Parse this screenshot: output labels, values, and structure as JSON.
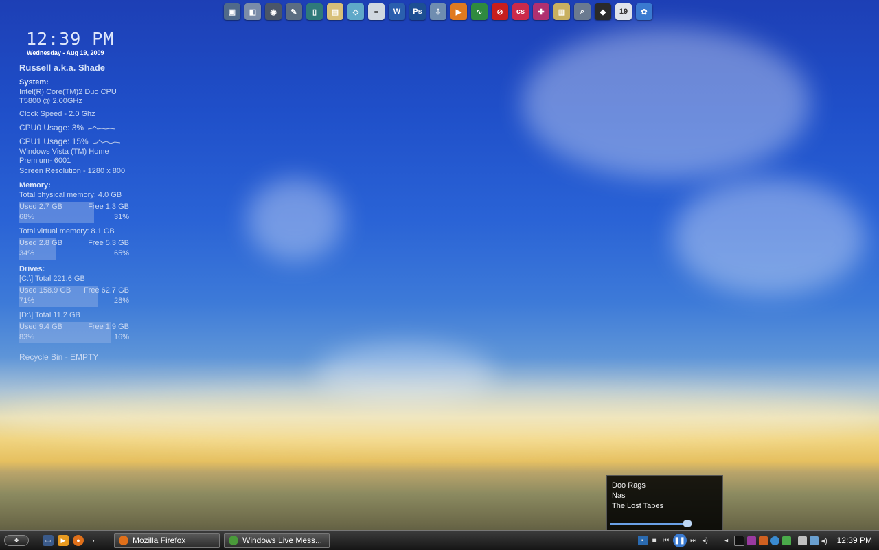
{
  "dock": {
    "icons": [
      {
        "name": "computer-icon",
        "color": "#506a8a",
        "glyph": "▣"
      },
      {
        "name": "documents-icon",
        "color": "#7b8ca8",
        "glyph": "◧"
      },
      {
        "name": "camera-icon",
        "color": "#4a5668",
        "glyph": "◉"
      },
      {
        "name": "tools-icon",
        "color": "#5b6d82",
        "glyph": "✎"
      },
      {
        "name": "mobile-icon",
        "color": "#2f7a7a",
        "glyph": "▯"
      },
      {
        "name": "folder-icon",
        "color": "#d8c078",
        "glyph": "▤"
      },
      {
        "name": "notes-icon",
        "color": "#5fa8c8",
        "glyph": "◇"
      },
      {
        "name": "text-file-icon",
        "color": "#d0d8e0",
        "glyph": "≡"
      },
      {
        "name": "word-icon",
        "color": "#2a5fae",
        "glyph": "W"
      },
      {
        "name": "photoshop-icon",
        "color": "#1d4f93",
        "glyph": "Ps"
      },
      {
        "name": "download-icon",
        "color": "#6f8db0",
        "glyph": "⇩"
      },
      {
        "name": "media-player-icon",
        "color": "#e07a20",
        "glyph": "▶"
      },
      {
        "name": "monitor-icon",
        "color": "#2f8a3f",
        "glyph": "∿"
      },
      {
        "name": "blocked-icon",
        "color": "#c81e1e",
        "glyph": "⊘"
      },
      {
        "name": "creative-suite-icon",
        "color": "#cc2a4a",
        "glyph": "cs"
      },
      {
        "name": "network-icon",
        "color": "#b03070",
        "glyph": "✚"
      },
      {
        "name": "archive-icon",
        "color": "#c8b060",
        "glyph": "▥"
      },
      {
        "name": "search-icon",
        "color": "#6a7a90",
        "glyph": "⌕"
      },
      {
        "name": "drive-icon",
        "color": "#2a2a2a",
        "glyph": "◆"
      },
      {
        "name": "calendar-icon",
        "color": "#dfe4ea",
        "glyph": "19"
      },
      {
        "name": "settings-icon",
        "color": "#3a7ad0",
        "glyph": "✿"
      }
    ]
  },
  "sysinfo": {
    "time": "12:39 PM",
    "date": "Wednesday - Aug 19, 2009",
    "user": "Russell a.k.a. Shade",
    "system_label": "System:",
    "cpu_model": "Intel(R) Core(TM)2 Duo CPU T5800  @ 2.00GHz",
    "clock_speed": "Clock Speed - 2.0  Ghz",
    "cpu0": "CPU0 Usage: 3%",
    "cpu1": "CPU1 Usage: 15%",
    "os": "Windows Vista (TM) Home Premium- 6001",
    "resolution": "Screen Resolution - 1280 x 800",
    "memory_label": "Memory:",
    "physical_total": "Total physical memory: 4.0 GB",
    "physical": {
      "used": "Used 2.7 GB",
      "free": "Free 1.3 GB",
      "used_pct": "68%",
      "free_pct": "31%",
      "fill": 0.68
    },
    "virtual_total": "Total virtual memory: 8.1 GB",
    "virtual": {
      "used": "Used 2.8 GB",
      "free": "Free 5.3 GB",
      "used_pct": "34%",
      "free_pct": "65%",
      "fill": 0.34
    },
    "drives_label": "Drives:",
    "c_total": "[C:\\] Total 221.6 GB",
    "c": {
      "used": "Used 158.9 GB",
      "free": "Free 62.7 GB",
      "used_pct": "71%",
      "free_pct": "28%",
      "fill": 0.71
    },
    "d_total": "[D:\\] Total 11.2 GB",
    "d": {
      "used": "Used 9.4 GB",
      "free": "Free 1.9 GB",
      "used_pct": "83%",
      "free_pct": "16%",
      "fill": 0.83
    },
    "recycle": "Recycle Bin - EMPTY"
  },
  "media": {
    "track": "Doo Rags",
    "artist": "Nas",
    "album": "The Lost Tapes",
    "progress": 0.85
  },
  "taskbar": {
    "start_icon": "windows-start-icon",
    "tasks": [
      {
        "label": "Mozilla Firefox",
        "color": "#e0701a"
      },
      {
        "label": "Windows Live Mess...",
        "color": "#4a9a3a"
      }
    ],
    "clock": "12:39 PM"
  }
}
